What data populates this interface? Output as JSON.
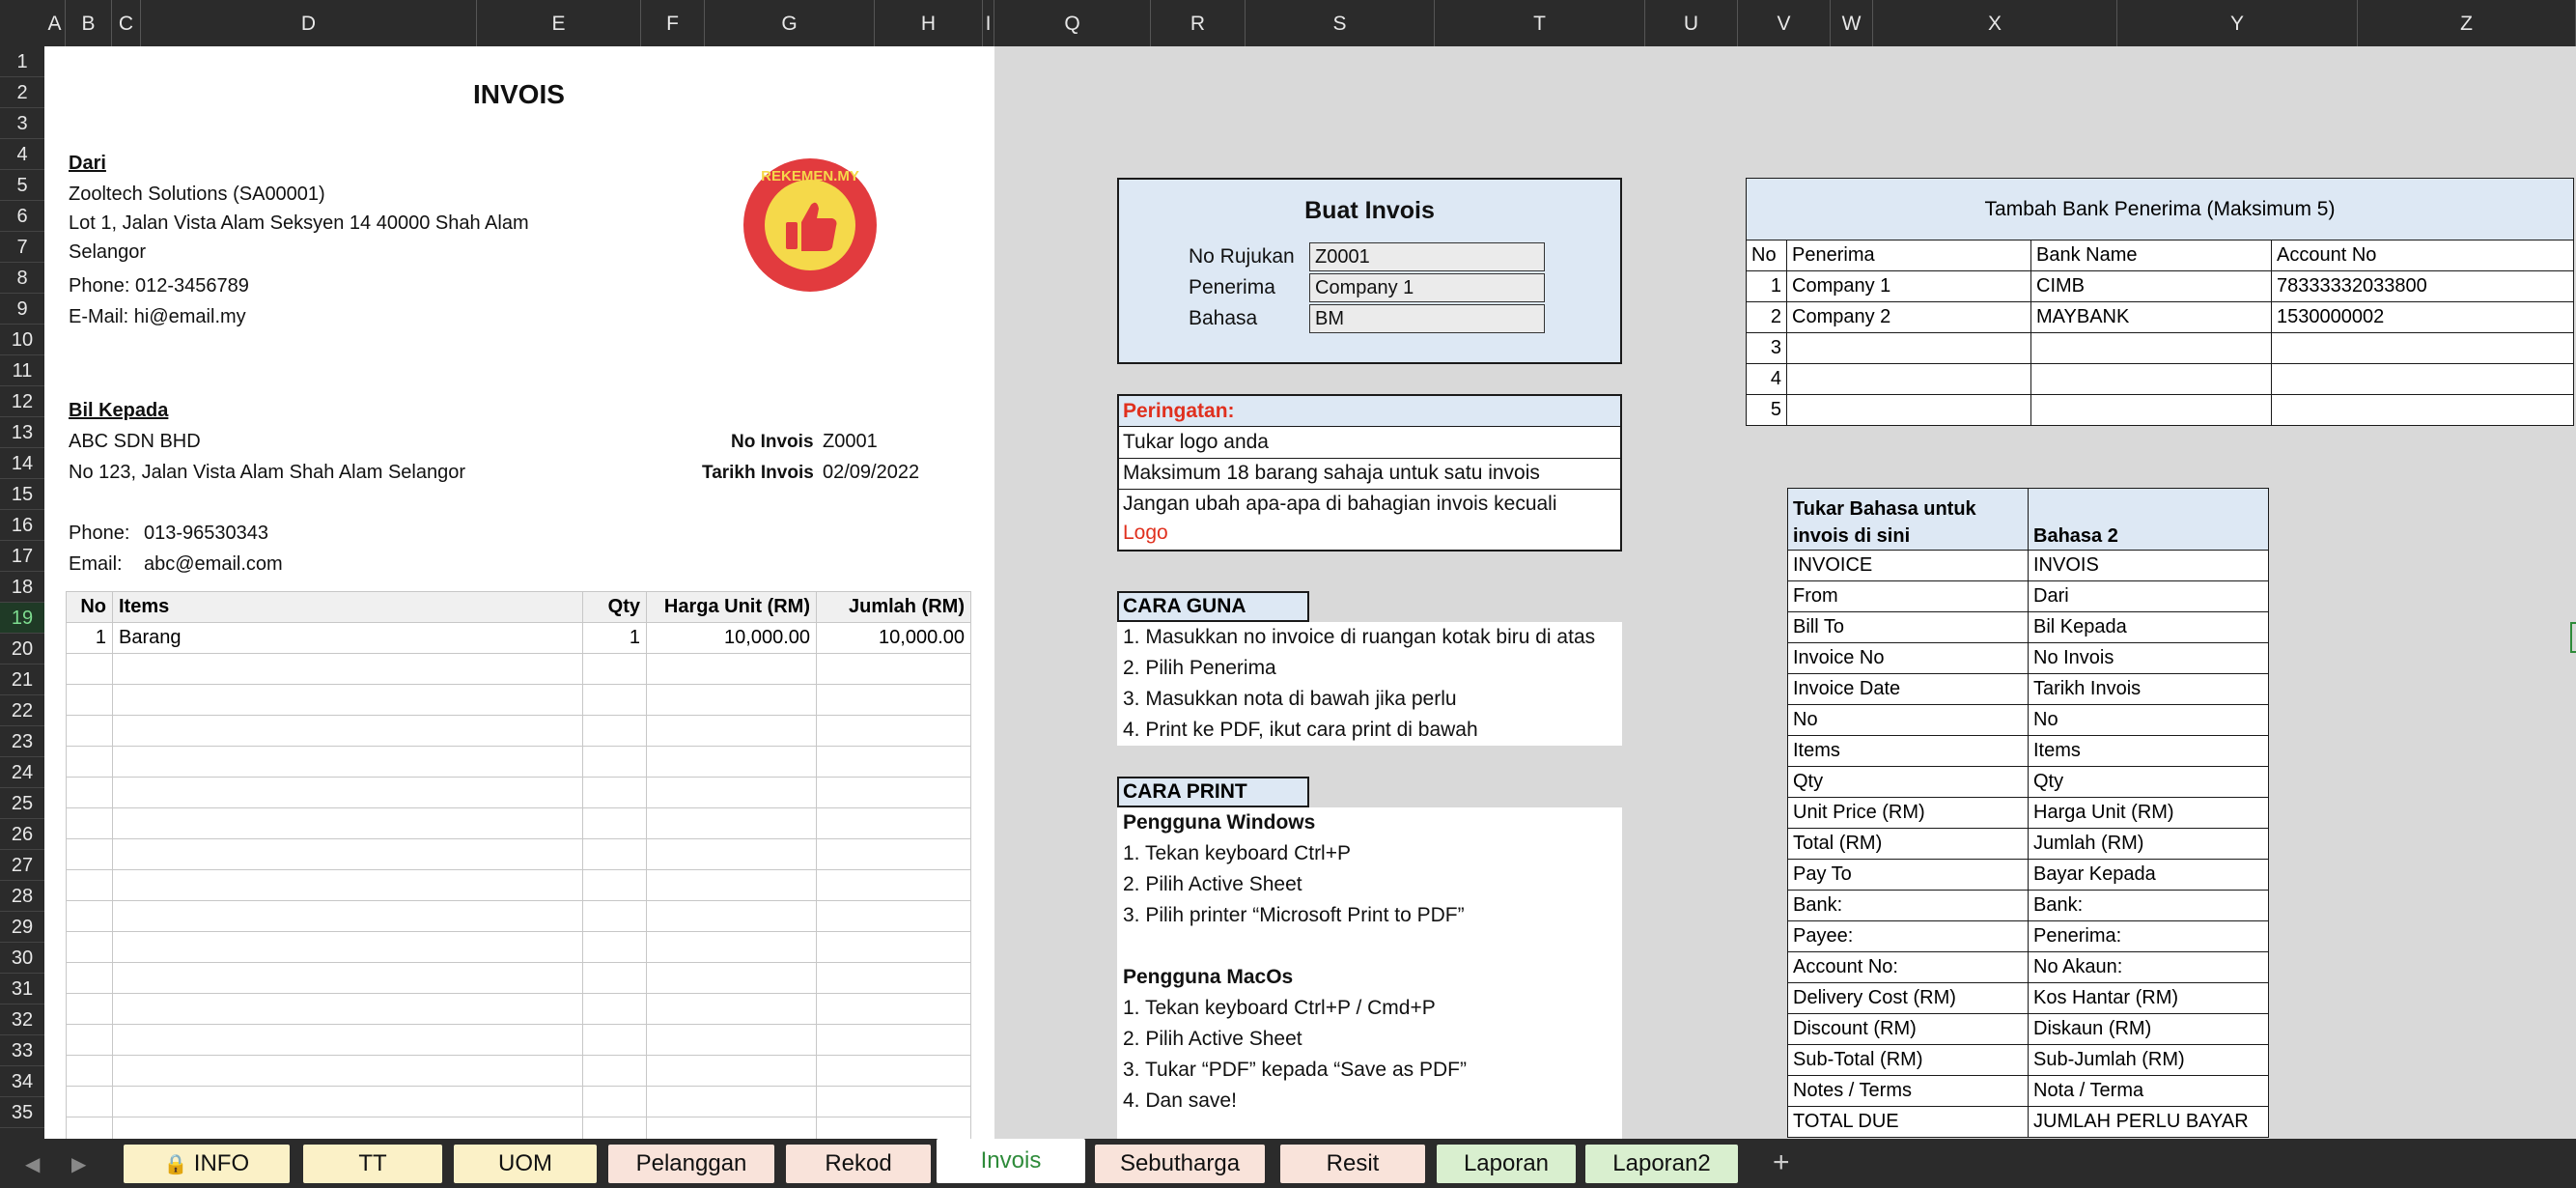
{
  "columns": [
    "A",
    "B",
    "C",
    "D",
    "E",
    "F",
    "G",
    "H",
    "I",
    "Q",
    "R",
    "S",
    "T",
    "U",
    "V",
    "W",
    "X",
    "Y",
    "Z"
  ],
  "rows": [
    "1",
    "2",
    "3",
    "4",
    "5",
    "6",
    "7",
    "8",
    "9",
    "10",
    "11",
    "12",
    "13",
    "14",
    "15",
    "16",
    "17",
    "18",
    "19",
    "20",
    "21",
    "22",
    "23",
    "24",
    "25",
    "26",
    "27",
    "28",
    "29",
    "30",
    "31",
    "32",
    "33",
    "34",
    "35"
  ],
  "invoice": {
    "title": "INVOIS",
    "from_label": "Dari",
    "from_name": "Zooltech Solutions (SA00001)",
    "from_addr1": "Lot 1, Jalan Vista Alam Seksyen 14 40000 Shah Alam",
    "from_addr2": "Selangor",
    "from_phone": "Phone: 012-3456789",
    "from_email": "E-Mail: hi@email.my",
    "logo_text": "REKEMEN.MY",
    "bill_label": "Bil Kepada",
    "bill_name": "ABC SDN BHD",
    "bill_addr": "No 123, Jalan Vista Alam Shah Alam Selangor",
    "no_label": "No Invois",
    "no_value": "Z0001",
    "date_label": "Tarikh Invois",
    "date_value": "02/09/2022",
    "phone_label": "Phone:",
    "phone_value": "013-96530343",
    "email_label": "Email:",
    "email_value": "abc@email.com",
    "table_headers": [
      "No",
      "Items",
      "Qty",
      "Harga Unit (RM)",
      "Jumlah (RM)"
    ],
    "table_rows": [
      [
        "1",
        "Barang",
        "1",
        "10,000.00",
        "10,000.00"
      ]
    ]
  },
  "buat": {
    "title": "Buat Invois",
    "rujukan_label": "No Rujukan",
    "rujukan_value": "Z0001",
    "penerima_label": "Penerima",
    "penerima_value": "Company 1",
    "bahasa_label": "Bahasa",
    "bahasa_value": "BM"
  },
  "peringatan": {
    "title": "Peringatan:",
    "items": [
      "Tukar logo anda",
      "Maksimum 18 barang sahaja untuk satu invois",
      "Jangan ubah apa-apa di bahagian invois kecuali"
    ],
    "logo_word": "Logo"
  },
  "cara_guna": {
    "title": "CARA GUNA",
    "items": [
      "1. Masukkan no invoice di ruangan kotak biru di atas",
      "2. Pilih Penerima",
      "3. Masukkan nota di bawah jika perlu",
      "4. Print ke PDF, ikut cara print di bawah"
    ]
  },
  "cara_print": {
    "title": "CARA PRINT",
    "windows_title": "Pengguna Windows",
    "windows_items": [
      "1. Tekan keyboard Ctrl+P",
      "2. Pilih Active Sheet",
      "3. Pilih printer “Microsoft Print to PDF”"
    ],
    "mac_title": "Pengguna MacOs",
    "mac_items": [
      "1. Tekan keyboard Ctrl+P / Cmd+P",
      "2. Pilih Active Sheet",
      "3. Tukar “PDF” kepada “Save as PDF”",
      "4. Dan save!"
    ]
  },
  "bank": {
    "title": "Tambah Bank Penerima (Maksimum 5)",
    "headers": [
      "No",
      "Penerima",
      "Bank Name",
      "Account No"
    ],
    "rows": [
      [
        "1",
        "Company 1",
        "CIMB",
        "78333332033800"
      ],
      [
        "2",
        "Company 2",
        "MAYBANK",
        "1530000002"
      ],
      [
        "3",
        "",
        "",
        ""
      ],
      [
        "4",
        "",
        "",
        ""
      ],
      [
        "5",
        "",
        "",
        ""
      ]
    ]
  },
  "lang": {
    "header1": "Tukar Bahasa untuk invois di sini",
    "header2": "Bahasa 2",
    "rows": [
      [
        "INVOICE",
        "INVOIS"
      ],
      [
        "From",
        "Dari"
      ],
      [
        "Bill To",
        "Bil Kepada"
      ],
      [
        "Invoice No",
        "No Invois"
      ],
      [
        "Invoice Date",
        "Tarikh Invois"
      ],
      [
        "No",
        "No"
      ],
      [
        "Items",
        "Items"
      ],
      [
        "Qty",
        "Qty"
      ],
      [
        "Unit Price (RM)",
        "Harga Unit (RM)"
      ],
      [
        "Total (RM)",
        "Jumlah (RM)"
      ],
      [
        "Pay To",
        "Bayar Kepada"
      ],
      [
        "Bank:",
        "Bank:"
      ],
      [
        "Payee:",
        "Penerima:"
      ],
      [
        "Account No:",
        "No Akaun:"
      ],
      [
        "Delivery Cost (RM)",
        "Kos Hantar (RM)"
      ],
      [
        "Discount (RM)",
        "Diskaun (RM)"
      ],
      [
        "Sub-Total (RM)",
        "Sub-Jumlah (RM)"
      ],
      [
        "Notes / Terms",
        "Nota / Terma"
      ],
      [
        "TOTAL DUE",
        "JUMLAH PERLU BAYAR"
      ]
    ]
  },
  "tabs": [
    {
      "label": "INFO",
      "color": "#fbf1c7"
    },
    {
      "label": "TT",
      "color": "#fbf1c7"
    },
    {
      "label": "UOM",
      "color": "#fbf1c7"
    },
    {
      "label": "Pelanggan",
      "color": "#f9e3da"
    },
    {
      "label": "Rekod",
      "color": "#f9e3da"
    },
    {
      "label": "Invois",
      "color": "#ffffff"
    },
    {
      "label": "Sebutharga",
      "color": "#f9e3da"
    },
    {
      "label": "Resit",
      "color": "#f9e3da"
    },
    {
      "label": "Laporan",
      "color": "#d9efcf"
    },
    {
      "label": "Laporan2",
      "color": "#d9efcf"
    }
  ],
  "add_tab": "+",
  "colors": {
    "accent": "#2e8b3a",
    "warn": "#e0301e",
    "panel_blue": "#dde8f4"
  }
}
